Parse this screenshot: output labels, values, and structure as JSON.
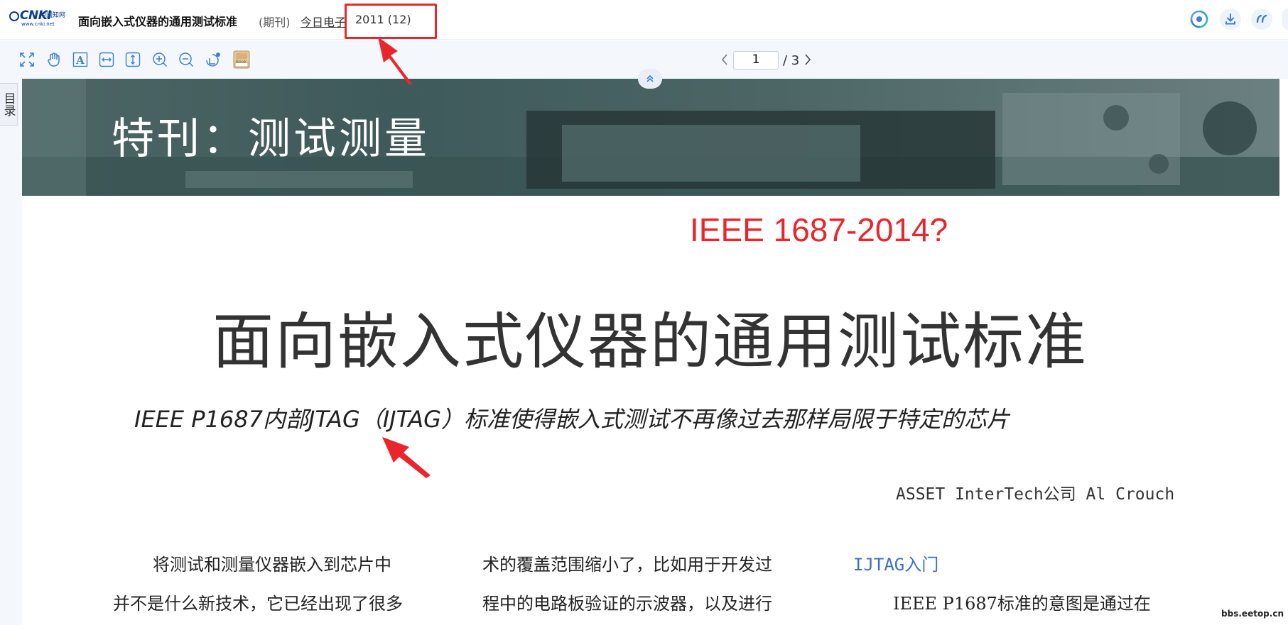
{
  "header": {
    "logo_text": "CNKI",
    "logo_cn": "中国知网",
    "logo_url": "www.cnki.net",
    "doc_title": "面向嵌入式仪器的通用测试标准",
    "doc_type": "(期刊)",
    "journal": "今日电子",
    "issue": "2011 (12)",
    "actions": [
      "ai-assistant-icon",
      "download-icon",
      "quote-icon"
    ]
  },
  "toolbar": {
    "tools": [
      "fullscreen-icon",
      "hand-icon",
      "text-select-icon",
      "fit-width-icon",
      "fit-height-icon",
      "zoom-in-icon",
      "zoom-out-icon",
      "rotate-icon",
      "book-icon"
    ],
    "book_label": "Book"
  },
  "pager": {
    "current": "1",
    "total": "/ 3"
  },
  "sidebar": {
    "toc_label": "目录"
  },
  "document": {
    "banner_title": "特刊：测试测量",
    "annotation": "IEEE 1687-2014?",
    "title": "面向嵌入式仪器的通用测试标准",
    "subtitle": "IEEE P1687内部JTAG（IJTAG）标准使得嵌入式测试不再像过去那样局限于特定的芯片",
    "author": "ASSET InterTech公司  Al Crouch",
    "col1_line1": "将测试和测量仪器嵌入到芯片中",
    "col1_line2": "并不是什么新技术，它已经出现了很多",
    "col2_line1": "术的覆盖范围缩小了，比如用于开发过",
    "col2_line2": "程中的电路板验证的示波器，以及进行",
    "col3_heading": "IJTAG入门",
    "col3_line2": "IEEE P1687标准的意图是通过在"
  },
  "watermark": "bbs.eetop.cn",
  "colors": {
    "highlight": "#e8262b",
    "link": "#3b6fc4",
    "icon": "#3d7fd0"
  }
}
